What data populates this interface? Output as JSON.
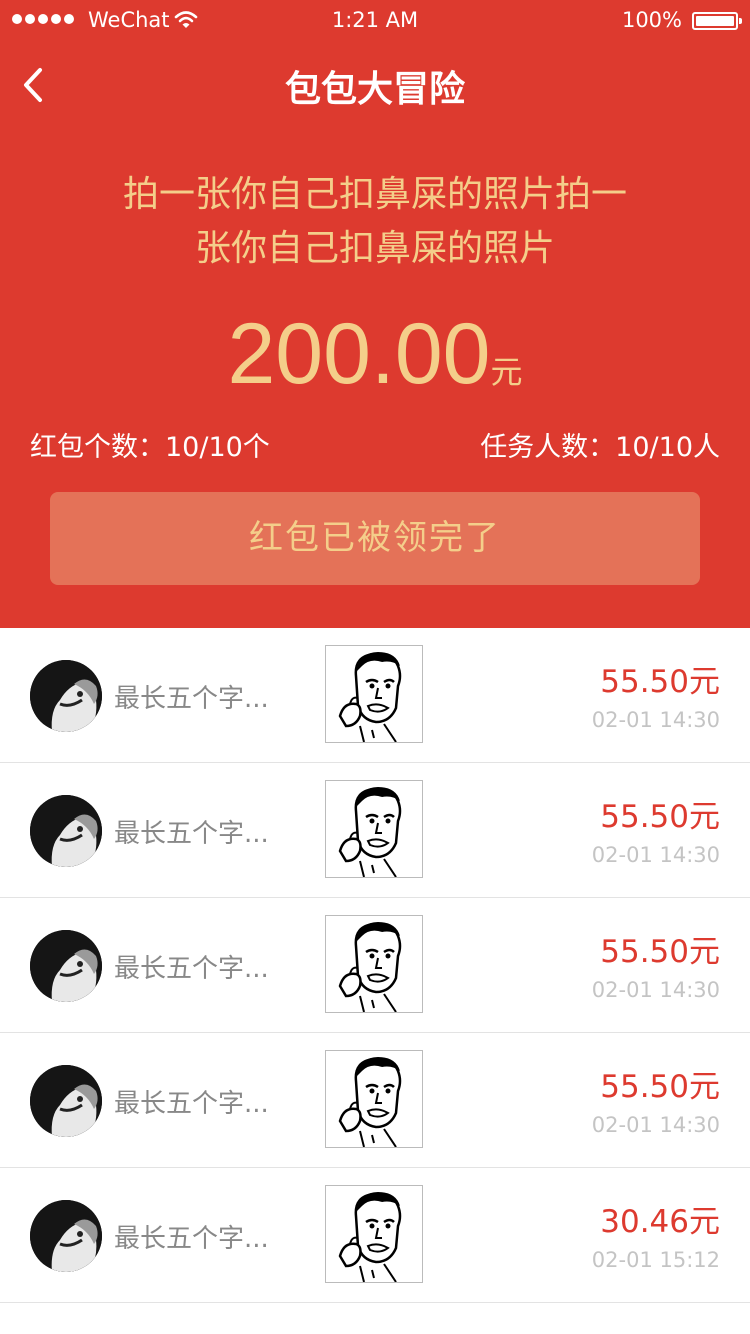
{
  "status_bar": {
    "carrier": "WeChat",
    "time": "1:21 AM",
    "battery": "100%",
    "battery_level": 1.0
  },
  "nav": {
    "title": "包包大冒险",
    "back_icon": "chevron-left-icon"
  },
  "task": {
    "line1": "拍一张你自己扣鼻屎的照片拍一",
    "line2": "张你自己扣鼻屎的照片"
  },
  "amount": {
    "value": "200.00",
    "unit": "元"
  },
  "counts": {
    "packets": "红包个数：10/10个",
    "people": "任务人数：10/10人"
  },
  "claim_button": {
    "label": "红包已被领完了"
  },
  "colors": {
    "header_bg": "#dd3a2f",
    "gold": "#f4ce8a",
    "button_bg": "#e47258",
    "money": "#dd3a2f"
  },
  "records": [
    {
      "name": "最长五个字...",
      "amount": "55.50元",
      "time": "02-01 14:30"
    },
    {
      "name": "最长五个字...",
      "amount": "55.50元",
      "time": "02-01 14:30"
    },
    {
      "name": "最长五个字...",
      "amount": "55.50元",
      "time": "02-01 14:30"
    },
    {
      "name": "最长五个字...",
      "amount": "55.50元",
      "time": "02-01 14:30"
    },
    {
      "name": "最长五个字...",
      "amount": "30.46元",
      "time": "02-01 15:12"
    }
  ]
}
